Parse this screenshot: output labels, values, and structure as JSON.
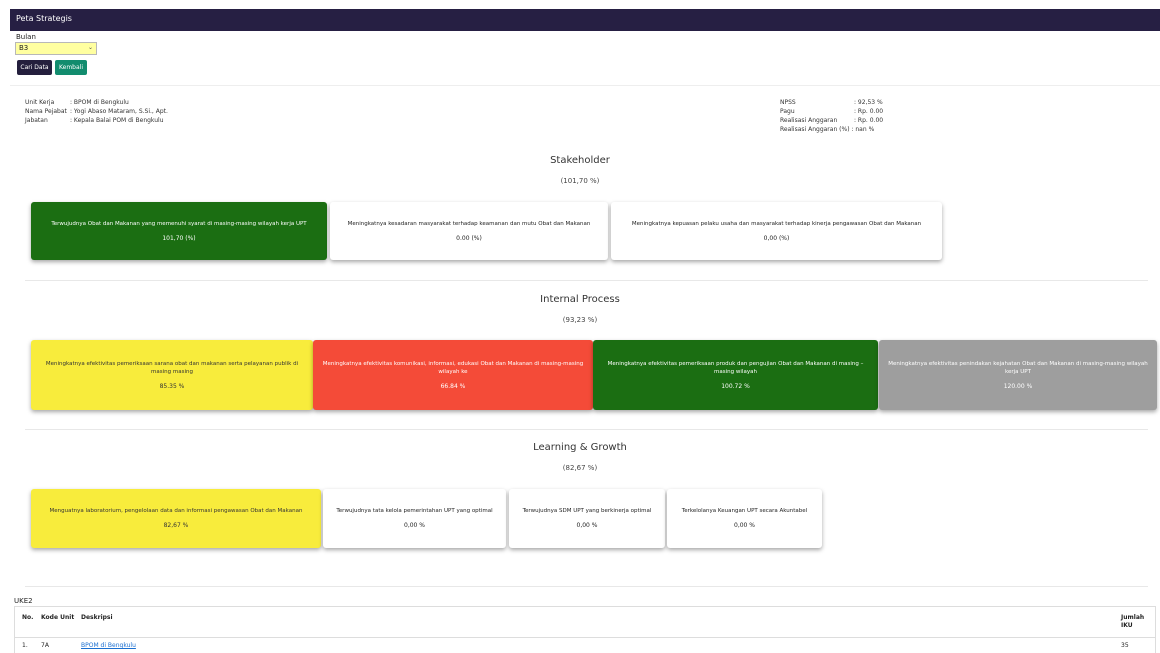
{
  "window": {
    "title": "Peta Strategis"
  },
  "filter": {
    "bulan_label": "Bulan",
    "bulan_value": "B3",
    "cari_label": "Cari Data",
    "kembali_label": "Kembali"
  },
  "info": {
    "unit_kerja_k": "Unit Kerja",
    "unit_kerja_v": ": BPOM di Bengkulu",
    "pejabat_k": "Nama Pejabat",
    "pejabat_v": ": Yogi Abaso Mataram, S.Si., Apt.",
    "jabatan_k": "Jabatan",
    "jabatan_v": ": Kepala Balai POM di Bengkulu",
    "npss_k": "NPSS",
    "npss_v": ": 92,53 %",
    "pagu_k": "Pagu",
    "pagu_v": ": Rp. 0.00",
    "realisasi_k": "Realisasi Anggaran",
    "realisasi_v": ": Rp. 0.00",
    "realisasi_pct": "Realisasi Anggaran (%) : nan %"
  },
  "stakeholder": {
    "title": "Stakeholder",
    "pct": "(101,70 %)",
    "cards": [
      {
        "desc": "Terwujudnya Obat dan Makanan yang memenuhi syarat di masing-masing wilayah kerja UPT",
        "val": "101,70 (%)",
        "color": "#1b6e12"
      },
      {
        "desc": "Meningkatnya kesadaran masyarakat terhadap keamanan dan mutu Obat dan Makanan",
        "val": "0.00 (%)",
        "color": "#ffffff"
      },
      {
        "desc": "Meningkatnya kepuasan pelaku usaha dan masyarakat terhadap kinerja pengawasan Obat dan Makanan",
        "val": "0,00 (%)",
        "color": "#ffffff"
      }
    ]
  },
  "internal": {
    "title": "Internal Process",
    "pct": "(93,23 %)",
    "cards": [
      {
        "desc": "Meningkatnya efektivitas pemeriksaan sarana obat dan makanan serta pelayanan publik di masing masing",
        "val": "85.35 %",
        "color": "#f8ec3c"
      },
      {
        "desc": "Meningkatnya efektivitas komunikasi, informasi, edukasi Obat dan Makanan di masing-masing wilayah ke",
        "val": "66.84 %",
        "color": "#f44b38"
      },
      {
        "desc": "Meningkatnya efektivitas pemeriksaan produk dan pengujian Obat dan Makanan di masing – masing wilayah",
        "val": "100.72 %",
        "color": "#1b6e12"
      },
      {
        "desc": "Meningkatnya efektivitas penindakan kejahatan Obat dan Makanan di masing-masing wilayah kerja UPT",
        "val": "120.00 %",
        "color": "#9e9e9e"
      }
    ]
  },
  "learning": {
    "title": "Learning & Growth",
    "pct": "(82,67 %)",
    "cards": [
      {
        "desc": "Menguatnya laboratorium, pengelolaan data dan informasi pengawasan Obat dan Makanan",
        "val": "82,67 %",
        "color": "#f8ec3c"
      },
      {
        "desc": "Terwujudnya tata kelola pemerintahan UPT yang optimal",
        "val": "0,00 %",
        "color": "#ffffff"
      },
      {
        "desc": "Terwujudnya SDM UPT yang berkinerja optimal",
        "val": "0,00 %",
        "color": "#ffffff"
      },
      {
        "desc": "Terkelolanya Keuangan UPT secara Akuntabel",
        "val": "0,00 %",
        "color": "#ffffff"
      }
    ]
  },
  "uke2": {
    "label": "UKE2",
    "headers": {
      "no": "No.",
      "kode": "Kode Unit",
      "desk": "Deskripsi",
      "jumlah1": "Jumlah",
      "jumlah2": "IKU"
    },
    "row": {
      "no": "1.",
      "kode": "7A",
      "desk": "BPOM di Bengkulu",
      "jumlah": "35"
    }
  }
}
